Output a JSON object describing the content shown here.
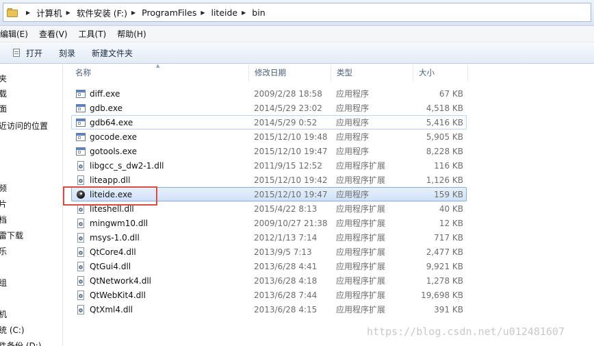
{
  "address": {
    "crumbs": [
      "计算机",
      "软件安装 (F:)",
      "ProgramFiles",
      "liteide",
      "bin"
    ]
  },
  "menu": [
    "编辑(E)",
    "查看(V)",
    "工具(T)",
    "帮助(H)"
  ],
  "toolbar": {
    "open_label": "打开",
    "burn_label": "刻录",
    "new_folder_label": "新建文件夹"
  },
  "nav": [
    "夹",
    "载",
    "面",
    "近访问的位置",
    "频",
    "片",
    "档",
    "雷下载",
    "乐",
    "组",
    "机",
    "统 (C:)",
    "件备份 (D:)"
  ],
  "columns": {
    "name": "名称",
    "date": "修改日期",
    "type": "类型",
    "size": "大小"
  },
  "files": [
    {
      "name": "diff.exe",
      "date": "2009/2/28 18:58",
      "type": "应用程序",
      "size": "67 KB",
      "icon": "exe-icon"
    },
    {
      "name": "gdb.exe",
      "date": "2014/5/29 23:02",
      "type": "应用程序",
      "size": "4,518 KB",
      "icon": "exe-icon"
    },
    {
      "name": "gdb64.exe",
      "date": "2014/5/29 0:52",
      "type": "应用程序",
      "size": "5,416 KB",
      "icon": "exe-icon"
    },
    {
      "name": "gocode.exe",
      "date": "2015/12/10 19:48",
      "type": "应用程序",
      "size": "5,905 KB",
      "icon": "exe-icon"
    },
    {
      "name": "gotools.exe",
      "date": "2015/12/10 19:47",
      "type": "应用程序",
      "size": "8,228 KB",
      "icon": "exe-icon"
    },
    {
      "name": "libgcc_s_dw2-1.dll",
      "date": "2011/9/15 12:52",
      "type": "应用程序扩展",
      "size": "116 KB",
      "icon": "dll-icon"
    },
    {
      "name": "liteapp.dll",
      "date": "2015/12/10 19:42",
      "type": "应用程序扩展",
      "size": "1,126 KB",
      "icon": "dll-icon"
    },
    {
      "name": "liteide.exe",
      "date": "2015/12/10 19:47",
      "type": "应用程序",
      "size": "159 KB",
      "icon": "liteide-icon"
    },
    {
      "name": "liteshell.dll",
      "date": "2015/4/22 8:13",
      "type": "应用程序扩展",
      "size": "40 KB",
      "icon": "dll-icon"
    },
    {
      "name": "mingwm10.dll",
      "date": "2009/10/27 21:38",
      "type": "应用程序扩展",
      "size": "12 KB",
      "icon": "dll-icon"
    },
    {
      "name": "msys-1.0.dll",
      "date": "2012/1/13 7:14",
      "type": "应用程序扩展",
      "size": "717 KB",
      "icon": "dll-icon"
    },
    {
      "name": "QtCore4.dll",
      "date": "2013/9/5 7:13",
      "type": "应用程序扩展",
      "size": "2,477 KB",
      "icon": "dll-icon"
    },
    {
      "name": "QtGui4.dll",
      "date": "2013/6/28 4:41",
      "type": "应用程序扩展",
      "size": "9,921 KB",
      "icon": "dll-icon"
    },
    {
      "name": "QtNetwork4.dll",
      "date": "2013/6/28 4:18",
      "type": "应用程序扩展",
      "size": "1,278 KB",
      "icon": "dll-icon"
    },
    {
      "name": "QtWebKit4.dll",
      "date": "2013/6/28 7:44",
      "type": "应用程序扩展",
      "size": "19,698 KB",
      "icon": "dll-icon"
    },
    {
      "name": "QtXml4.dll",
      "date": "2013/6/28 4:15",
      "type": "应用程序扩展",
      "size": "391 KB",
      "icon": "dll-icon"
    }
  ],
  "hover_file": "gdb64.exe",
  "selected_file": "liteide.exe",
  "watermark": "https://blog.csdn.net/u012481607",
  "colors": {
    "highlight": "#d94b3e",
    "selection": "#d1e2f7"
  }
}
